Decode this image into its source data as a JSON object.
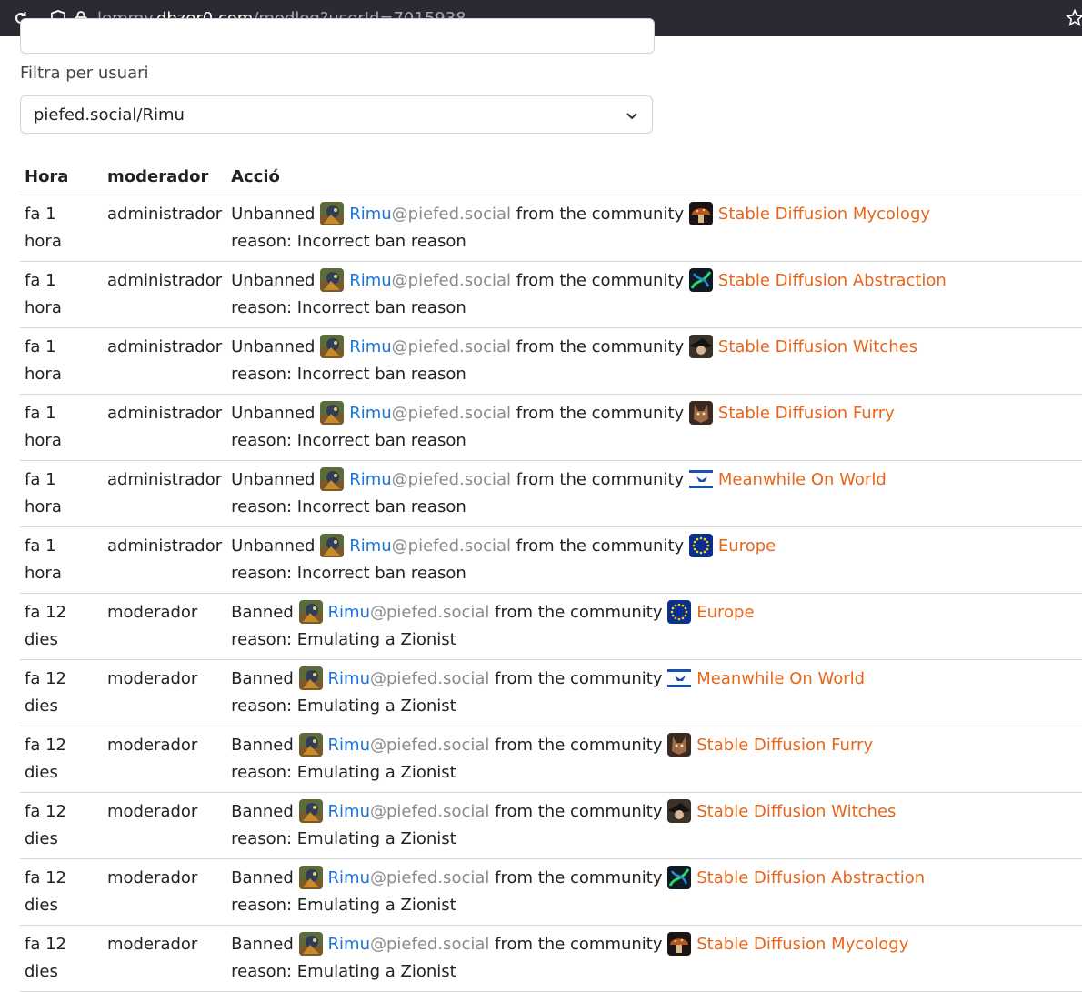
{
  "browser": {
    "url_host_prefix": "lemmy.",
    "url_host": "dbzer0.com",
    "url_path": "/modlog?userId=7015938"
  },
  "filter": {
    "label": "Filtra per usuari",
    "selected_user": "piefed.social/Rimu"
  },
  "table": {
    "headers": {
      "time": "Hora",
      "moderator": "moderador",
      "action": "Acció"
    },
    "rows": [
      {
        "time": "fa 1 hora",
        "moderator": "administrador",
        "verb": "Unbanned",
        "user": "Rimu",
        "user_host": "@piefed.social",
        "middle": "from the community",
        "community": "Stable Diffusion Mycology",
        "community_icon": "mushroom",
        "reason": "reason: Incorrect ban reason"
      },
      {
        "time": "fa 1 hora",
        "moderator": "administrador",
        "verb": "Unbanned",
        "user": "Rimu",
        "user_host": "@piefed.social",
        "middle": "from the community",
        "community": "Stable Diffusion Abstraction",
        "community_icon": "abstract",
        "reason": "reason: Incorrect ban reason"
      },
      {
        "time": "fa 1 hora",
        "moderator": "administrador",
        "verb": "Unbanned",
        "user": "Rimu",
        "user_host": "@piefed.social",
        "middle": "from the community",
        "community": "Stable Diffusion Witches",
        "community_icon": "witch",
        "reason": "reason: Incorrect ban reason"
      },
      {
        "time": "fa 1 hora",
        "moderator": "administrador",
        "verb": "Unbanned",
        "user": "Rimu",
        "user_host": "@piefed.social",
        "middle": "from the community",
        "community": "Stable Diffusion Furry",
        "community_icon": "furry",
        "reason": "reason: Incorrect ban reason"
      },
      {
        "time": "fa 1 hora",
        "moderator": "administrador",
        "verb": "Unbanned",
        "user": "Rimu",
        "user_host": "@piefed.social",
        "middle": "from the community",
        "community": "Meanwhile On World",
        "community_icon": "flag",
        "reason": "reason: Incorrect ban reason"
      },
      {
        "time": "fa 1 hora",
        "moderator": "administrador",
        "verb": "Unbanned",
        "user": "Rimu",
        "user_host": "@piefed.social",
        "middle": "from the community",
        "community": "Europe",
        "community_icon": "eu",
        "reason": "reason: Incorrect ban reason"
      },
      {
        "time": "fa 12 dies",
        "moderator": "moderador",
        "verb": "Banned",
        "user": "Rimu",
        "user_host": "@piefed.social",
        "middle": "from the community",
        "community": "Europe",
        "community_icon": "eu",
        "reason": "reason: Emulating a Zionist"
      },
      {
        "time": "fa 12 dies",
        "moderator": "moderador",
        "verb": "Banned",
        "user": "Rimu",
        "user_host": "@piefed.social",
        "middle": "from the community",
        "community": "Meanwhile On World",
        "community_icon": "flag",
        "reason": "reason: Emulating a Zionist"
      },
      {
        "time": "fa 12 dies",
        "moderator": "moderador",
        "verb": "Banned",
        "user": "Rimu",
        "user_host": "@piefed.social",
        "middle": "from the community",
        "community": "Stable Diffusion Furry",
        "community_icon": "furry",
        "reason": "reason: Emulating a Zionist"
      },
      {
        "time": "fa 12 dies",
        "moderator": "moderador",
        "verb": "Banned",
        "user": "Rimu",
        "user_host": "@piefed.social",
        "middle": "from the community",
        "community": "Stable Diffusion Witches",
        "community_icon": "witch",
        "reason": "reason: Emulating a Zionist"
      },
      {
        "time": "fa 12 dies",
        "moderator": "moderador",
        "verb": "Banned",
        "user": "Rimu",
        "user_host": "@piefed.social",
        "middle": "from the community",
        "community": "Stable Diffusion Abstraction",
        "community_icon": "abstract",
        "reason": "reason: Emulating a Zionist"
      },
      {
        "time": "fa 12 dies",
        "moderator": "moderador",
        "verb": "Banned",
        "user": "Rimu",
        "user_host": "@piefed.social",
        "middle": "from the community",
        "community": "Stable Diffusion Mycology",
        "community_icon": "mushroom",
        "reason": "reason: Emulating a Zionist"
      }
    ]
  },
  "colors": {
    "user_link": "#1a73d9",
    "community_link": "#e8661a",
    "host_gray": "#8a8a8a"
  }
}
